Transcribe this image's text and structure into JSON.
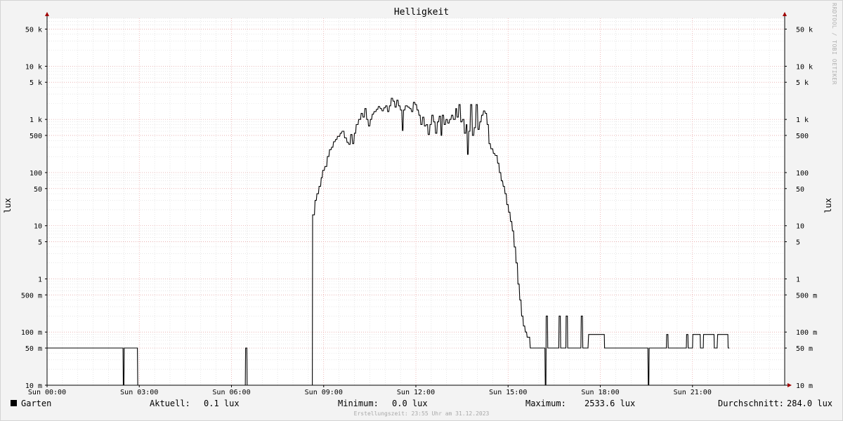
{
  "watermark": "RRDTOOL / TOBI OETIKER",
  "chart_data": {
    "type": "line",
    "title": "Helligkeit",
    "ylabel": "lux",
    "yscale": "log",
    "ylim": [
      0.01,
      80000
    ],
    "xlim_hours": [
      0,
      24
    ],
    "x_ticks": [
      {
        "h": 0,
        "label": "Sun 00:00"
      },
      {
        "h": 3,
        "label": "Sun 03:00"
      },
      {
        "h": 6,
        "label": "Sun 06:00"
      },
      {
        "h": 9,
        "label": "Sun 09:00"
      },
      {
        "h": 12,
        "label": "Sun 12:00"
      },
      {
        "h": 15,
        "label": "Sun 15:00"
      },
      {
        "h": 18,
        "label": "Sun 18:00"
      },
      {
        "h": 21,
        "label": "Sun 21:00"
      }
    ],
    "y_ticks": [
      {
        "v": 0.01,
        "label": "10 m"
      },
      {
        "v": 0.05,
        "label": "50 m"
      },
      {
        "v": 0.1,
        "label": "100 m"
      },
      {
        "v": 0.5,
        "label": "500 m"
      },
      {
        "v": 1,
        "label": "1"
      },
      {
        "v": 5,
        "label": "5"
      },
      {
        "v": 10,
        "label": "10"
      },
      {
        "v": 50,
        "label": "50"
      },
      {
        "v": 100,
        "label": "100"
      },
      {
        "v": 500,
        "label": "500"
      },
      {
        "v": 1000,
        "label": "1 k"
      },
      {
        "v": 5000,
        "label": "5 k"
      },
      {
        "v": 10000,
        "label": "10 k"
      },
      {
        "v": 50000,
        "label": "50 k"
      }
    ],
    "grid": true,
    "colors": {
      "line": "#000000",
      "major_grid": "#e8a0a0",
      "minor_grid": "#d8d8d8",
      "axis": "#000000",
      "arrow": "#a00000",
      "plot_bg": "#ffffff"
    },
    "series": [
      {
        "name": "Garten",
        "points": [
          [
            0.0,
            0.05
          ],
          [
            2.47,
            0.05
          ],
          [
            2.48,
            0.01
          ],
          [
            2.5,
            0.01
          ],
          [
            2.51,
            0.05
          ],
          [
            2.94,
            0.05
          ],
          [
            2.95,
            0.01
          ],
          [
            6.45,
            0.01
          ],
          [
            6.46,
            0.05
          ],
          [
            6.5,
            0.05
          ],
          [
            6.51,
            0.01
          ],
          [
            8.63,
            0.01
          ],
          [
            8.64,
            16
          ],
          [
            8.7,
            16
          ],
          [
            8.72,
            30
          ],
          [
            8.76,
            30
          ],
          [
            8.78,
            40
          ],
          [
            8.83,
            40
          ],
          [
            8.85,
            55
          ],
          [
            8.9,
            55
          ],
          [
            8.92,
            80
          ],
          [
            8.95,
            80
          ],
          [
            8.97,
            110
          ],
          [
            9.02,
            110
          ],
          [
            9.04,
            130
          ],
          [
            9.1,
            130
          ],
          [
            9.12,
            200
          ],
          [
            9.17,
            200
          ],
          [
            9.19,
            270
          ],
          [
            9.24,
            270
          ],
          [
            9.26,
            300
          ],
          [
            9.3,
            300
          ],
          [
            9.32,
            380
          ],
          [
            9.37,
            380
          ],
          [
            9.39,
            420
          ],
          [
            9.43,
            420
          ],
          [
            9.45,
            480
          ],
          [
            9.52,
            480
          ],
          [
            9.54,
            550
          ],
          [
            9.58,
            550
          ],
          [
            9.6,
            600
          ],
          [
            9.66,
            600
          ],
          [
            9.68,
            450
          ],
          [
            9.74,
            450
          ],
          [
            9.76,
            370
          ],
          [
            9.8,
            370
          ],
          [
            9.82,
            340
          ],
          [
            9.86,
            340
          ],
          [
            9.88,
            520
          ],
          [
            9.92,
            520
          ],
          [
            9.94,
            350
          ],
          [
            9.98,
            350
          ],
          [
            10.0,
            550
          ],
          [
            10.04,
            550
          ],
          [
            10.06,
            800
          ],
          [
            10.12,
            800
          ],
          [
            10.14,
            1000
          ],
          [
            10.2,
            1000
          ],
          [
            10.22,
            1300
          ],
          [
            10.26,
            1300
          ],
          [
            10.28,
            1100
          ],
          [
            10.32,
            1100
          ],
          [
            10.34,
            1600
          ],
          [
            10.38,
            1600
          ],
          [
            10.4,
            1000
          ],
          [
            10.44,
            1000
          ],
          [
            10.46,
            750
          ],
          [
            10.5,
            750
          ],
          [
            10.52,
            1000
          ],
          [
            10.56,
            1000
          ],
          [
            10.58,
            1250
          ],
          [
            10.62,
            1250
          ],
          [
            10.64,
            1400
          ],
          [
            10.7,
            1400
          ],
          [
            10.72,
            1550
          ],
          [
            10.76,
            1550
          ],
          [
            10.78,
            1750
          ],
          [
            10.82,
            1750
          ],
          [
            10.84,
            1600
          ],
          [
            10.88,
            1600
          ],
          [
            10.9,
            1450
          ],
          [
            10.94,
            1450
          ],
          [
            10.96,
            1650
          ],
          [
            11.0,
            1650
          ],
          [
            11.02,
            1800
          ],
          [
            11.06,
            1800
          ],
          [
            11.08,
            1400
          ],
          [
            11.12,
            1400
          ],
          [
            11.14,
            1800
          ],
          [
            11.18,
            1800
          ],
          [
            11.2,
            2500
          ],
          [
            11.24,
            2500
          ],
          [
            11.26,
            2200
          ],
          [
            11.3,
            2200
          ],
          [
            11.32,
            1700
          ],
          [
            11.36,
            1700
          ],
          [
            11.38,
            2300
          ],
          [
            11.42,
            2300
          ],
          [
            11.44,
            1800
          ],
          [
            11.48,
            1800
          ],
          [
            11.5,
            1500
          ],
          [
            11.54,
            1500
          ],
          [
            11.56,
            620
          ],
          [
            11.58,
            620
          ],
          [
            11.6,
            1500
          ],
          [
            11.64,
            1500
          ],
          [
            11.66,
            1800
          ],
          [
            11.72,
            1800
          ],
          [
            11.74,
            1700
          ],
          [
            11.78,
            1700
          ],
          [
            11.8,
            1600
          ],
          [
            11.84,
            1600
          ],
          [
            11.86,
            1400
          ],
          [
            11.9,
            1400
          ],
          [
            11.92,
            2100
          ],
          [
            11.96,
            2100
          ],
          [
            11.98,
            1900
          ],
          [
            12.02,
            1900
          ],
          [
            12.04,
            1500
          ],
          [
            12.08,
            1500
          ],
          [
            12.1,
            1200
          ],
          [
            12.14,
            1200
          ],
          [
            12.16,
            800
          ],
          [
            12.2,
            800
          ],
          [
            12.22,
            1100
          ],
          [
            12.26,
            1100
          ],
          [
            12.28,
            750
          ],
          [
            12.32,
            750
          ],
          [
            12.34,
            800
          ],
          [
            12.38,
            800
          ],
          [
            12.4,
            520
          ],
          [
            12.44,
            520
          ],
          [
            12.46,
            800
          ],
          [
            12.5,
            800
          ],
          [
            12.52,
            1200
          ],
          [
            12.56,
            1200
          ],
          [
            12.58,
            900
          ],
          [
            12.62,
            900
          ],
          [
            12.64,
            550
          ],
          [
            12.68,
            550
          ],
          [
            12.7,
            900
          ],
          [
            12.74,
            900
          ],
          [
            12.76,
            1150
          ],
          [
            12.8,
            1150
          ],
          [
            12.82,
            500
          ],
          [
            12.84,
            500
          ],
          [
            12.86,
            1200
          ],
          [
            12.9,
            1200
          ],
          [
            12.92,
            800
          ],
          [
            12.96,
            800
          ],
          [
            12.98,
            1000
          ],
          [
            13.02,
            1000
          ],
          [
            13.04,
            850
          ],
          [
            13.08,
            850
          ],
          [
            13.1,
            1000
          ],
          [
            13.14,
            1000
          ],
          [
            13.16,
            1200
          ],
          [
            13.2,
            1200
          ],
          [
            13.22,
            1000
          ],
          [
            13.28,
            1000
          ],
          [
            13.3,
            1600
          ],
          [
            13.32,
            1600
          ],
          [
            13.34,
            1100
          ],
          [
            13.38,
            1100
          ],
          [
            13.4,
            1900
          ],
          [
            13.44,
            1900
          ],
          [
            13.46,
            900
          ],
          [
            13.5,
            900
          ],
          [
            13.52,
            1000
          ],
          [
            13.56,
            1000
          ],
          [
            13.58,
            550
          ],
          [
            13.62,
            550
          ],
          [
            13.64,
            800
          ],
          [
            13.66,
            800
          ],
          [
            13.68,
            220
          ],
          [
            13.7,
            220
          ],
          [
            13.72,
            600
          ],
          [
            13.76,
            600
          ],
          [
            13.78,
            1900
          ],
          [
            13.82,
            1900
          ],
          [
            13.84,
            500
          ],
          [
            13.88,
            500
          ],
          [
            13.9,
            700
          ],
          [
            13.94,
            700
          ],
          [
            13.96,
            1900
          ],
          [
            14.0,
            1900
          ],
          [
            14.02,
            650
          ],
          [
            14.06,
            650
          ],
          [
            14.08,
            900
          ],
          [
            14.12,
            900
          ],
          [
            14.14,
            1200
          ],
          [
            14.18,
            1200
          ],
          [
            14.2,
            1450
          ],
          [
            14.24,
            1450
          ],
          [
            14.26,
            1300
          ],
          [
            14.3,
            1300
          ],
          [
            14.32,
            800
          ],
          [
            14.36,
            800
          ],
          [
            14.38,
            350
          ],
          [
            14.42,
            350
          ],
          [
            14.44,
            280
          ],
          [
            14.5,
            280
          ],
          [
            14.52,
            230
          ],
          [
            14.56,
            230
          ],
          [
            14.58,
            210
          ],
          [
            14.64,
            210
          ],
          [
            14.66,
            150
          ],
          [
            14.7,
            150
          ],
          [
            14.72,
            100
          ],
          [
            14.76,
            100
          ],
          [
            14.78,
            70
          ],
          [
            14.82,
            70
          ],
          [
            14.84,
            55
          ],
          [
            14.88,
            55
          ],
          [
            14.9,
            40
          ],
          [
            14.94,
            40
          ],
          [
            14.96,
            25
          ],
          [
            15.0,
            25
          ],
          [
            15.02,
            18
          ],
          [
            15.06,
            18
          ],
          [
            15.08,
            12
          ],
          [
            15.12,
            12
          ],
          [
            15.14,
            8
          ],
          [
            15.18,
            8
          ],
          [
            15.2,
            4
          ],
          [
            15.24,
            4
          ],
          [
            15.26,
            2
          ],
          [
            15.3,
            2
          ],
          [
            15.32,
            0.8
          ],
          [
            15.36,
            0.8
          ],
          [
            15.38,
            0.4
          ],
          [
            15.42,
            0.4
          ],
          [
            15.44,
            0.2
          ],
          [
            15.48,
            0.2
          ],
          [
            15.5,
            0.13
          ],
          [
            15.54,
            0.13
          ],
          [
            15.56,
            0.1
          ],
          [
            15.6,
            0.1
          ],
          [
            15.62,
            0.08
          ],
          [
            15.7,
            0.08
          ],
          [
            15.72,
            0.05
          ],
          [
            16.2,
            0.05
          ],
          [
            16.21,
            0.01
          ],
          [
            16.23,
            0.01
          ],
          [
            16.24,
            0.2
          ],
          [
            16.28,
            0.2
          ],
          [
            16.29,
            0.05
          ],
          [
            16.65,
            0.05
          ],
          [
            16.66,
            0.2
          ],
          [
            16.7,
            0.2
          ],
          [
            16.71,
            0.05
          ],
          [
            16.88,
            0.05
          ],
          [
            16.89,
            0.2
          ],
          [
            16.93,
            0.2
          ],
          [
            16.94,
            0.05
          ],
          [
            17.37,
            0.05
          ],
          [
            17.38,
            0.2
          ],
          [
            17.42,
            0.2
          ],
          [
            17.43,
            0.05
          ],
          [
            17.6,
            0.05
          ],
          [
            17.62,
            0.09
          ],
          [
            18.13,
            0.09
          ],
          [
            18.14,
            0.05
          ],
          [
            19.55,
            0.05
          ],
          [
            19.56,
            0.01
          ],
          [
            19.58,
            0.01
          ],
          [
            19.59,
            0.05
          ],
          [
            20.15,
            0.05
          ],
          [
            20.16,
            0.09
          ],
          [
            20.2,
            0.09
          ],
          [
            20.21,
            0.05
          ],
          [
            20.8,
            0.05
          ],
          [
            20.81,
            0.09
          ],
          [
            20.85,
            0.09
          ],
          [
            20.86,
            0.05
          ],
          [
            21.0,
            0.05
          ],
          [
            21.01,
            0.09
          ],
          [
            21.25,
            0.09
          ],
          [
            21.26,
            0.05
          ],
          [
            21.35,
            0.05
          ],
          [
            21.36,
            0.09
          ],
          [
            21.7,
            0.09
          ],
          [
            21.71,
            0.05
          ],
          [
            21.8,
            0.05
          ],
          [
            21.82,
            0.09
          ],
          [
            22.15,
            0.09
          ],
          [
            22.16,
            0.05
          ],
          [
            22.2,
            0.05
          ]
        ]
      }
    ]
  },
  "legend": {
    "series_name": "Garten",
    "current_label": "Aktuell:",
    "current_value": "0.1 lux",
    "min_label": "Minimum:",
    "min_value": "0.0 lux",
    "max_label": "Maximum:",
    "max_value": "2533.6 lux",
    "avg_label": "Durchschnitt:",
    "avg_value": "284.0 lux"
  },
  "footer": "Erstellungszeit: 23:55 Uhr am 31.12.2023"
}
